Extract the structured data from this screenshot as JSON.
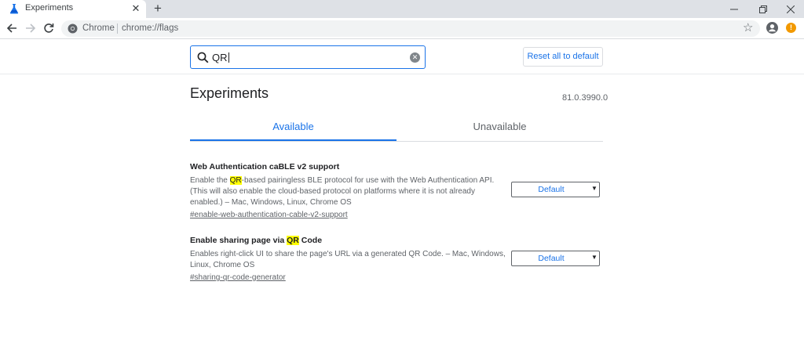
{
  "browser": {
    "tab_title": "Experiments",
    "new_tab_glyph": "+",
    "tab_close_glyph": "✕",
    "chip_label": "Chrome",
    "url": "chrome://flags",
    "star_glyph": "☆",
    "update_glyph": "!"
  },
  "flags_header": {
    "search_value": "QR",
    "reset_label": "Reset all to default"
  },
  "main": {
    "title": "Experiments",
    "version": "81.0.3990.0",
    "tabs": [
      {
        "label": "Available",
        "selected": true
      },
      {
        "label": "Unavailable",
        "selected": false
      }
    ]
  },
  "experiments": [
    {
      "title_before": "Web Authentication caBLE v2 support",
      "title_highlight": "",
      "title_after": "",
      "desc_before": "Enable the ",
      "desc_highlight": "QR",
      "desc_after": "-based pairingless BLE protocol for use with the Web Authentication API. (This will also enable the cloud-based protocol on platforms where it is not already enabled.) – Mac, Windows, Linux, Chrome OS",
      "link": "#enable-web-authentication-cable-v2-support",
      "select_value": "Default"
    },
    {
      "title_before": "Enable sharing page via ",
      "title_highlight": "QR",
      "title_after": " Code",
      "desc_before": "Enables right-click UI to share the page's URL via a generated QR Code. – Mac, Windows, Linux, Chrome OS",
      "desc_highlight": "",
      "desc_after": "",
      "link": "#sharing-qr-code-generator",
      "select_value": "Default"
    }
  ],
  "colors": {
    "accent": "#1a73e8",
    "highlight": "#ffff00",
    "tabstrip": "#dee1e6",
    "update_badge": "#f29900"
  }
}
